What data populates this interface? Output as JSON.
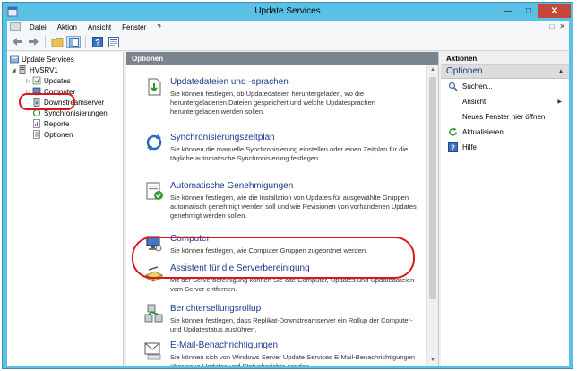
{
  "window": {
    "title": "Update Services",
    "minimize": "—",
    "maximize": "□",
    "close": "✕"
  },
  "menu": {
    "items": [
      "Datei",
      "Aktion",
      "Ansicht",
      "Fenster",
      "?"
    ],
    "right_controls": [
      "_",
      "□",
      "✕"
    ]
  },
  "toolbar": {
    "icons": [
      "back-arrow-icon",
      "forward-arrow-icon",
      "folder-up-icon",
      "console-tree-icon",
      "help-icon",
      "properties-icon"
    ]
  },
  "tree": {
    "root": "Update Services",
    "server": "HVSRV1",
    "children": [
      "Updates",
      "Computer",
      "Downstreamserver",
      "Synchronisierungen",
      "Reporte",
      "Optionen"
    ]
  },
  "center": {
    "header": "Optionen",
    "options": [
      {
        "title": "Updatedateien und -sprachen",
        "desc": "Sie können festlegen, ob Updatedateien heruntergeladen, wo die heruntergeladenen Dateien gespeichert und welche Updatesprachen heruntergeladen werden sollen."
      },
      {
        "title": "Synchronisierungszeitplan",
        "desc": "Sie können die manuelle Synchronisierung einstellen oder einen Zeitplan für die tägliche automatische Synchronisierung festlegen."
      },
      {
        "title": "Automatische Genehmigungen",
        "desc": "Sie können festlegen, wie die Installation von Updates für ausgewählte Gruppen automatisch genehmigt werden soll und wie Revisionen von vorhandenen Updates genehmigt werden sollen."
      },
      {
        "title": "Computer",
        "desc": "Sie können festlegen, wie Computer Gruppen zugeordnet werden."
      },
      {
        "title": "Assistent für die Serverbereinigung",
        "desc": "Mit der Serverbereinigung können Sie alte Computer, Updates und Updatedateien vom Server entfernen."
      },
      {
        "title": "Berichtersellungsrollup",
        "desc": "Sie können festlegen, dass Replikat-Downstreamserver ein Rollup der Computer- und Updatestatus ausführen."
      },
      {
        "title": "E-Mail-Benachrichtigungen",
        "desc": "Sie können sich von Windows Server Update Services E-Mail-Benachrichtigungen über neue Updates und Statusberichte senden"
      }
    ]
  },
  "actions": {
    "header": "Aktionen",
    "section": "Optionen",
    "items": [
      {
        "label": "Suchen...",
        "icon": "search-icon"
      },
      {
        "label": "Ansicht",
        "icon": "",
        "submenu": true
      },
      {
        "label": "Neues Fenster hier öffnen",
        "icon": ""
      },
      {
        "label": "Aktualisieren",
        "icon": "refresh-icon"
      },
      {
        "label": "Hilfe",
        "icon": "help-icon"
      }
    ]
  },
  "colors": {
    "title_bar": "#5ac0e6",
    "close_button": "#c7463a",
    "highlight": "#e0141e",
    "link_text": "#1a3a8c",
    "pane_header": "#7b848c"
  }
}
